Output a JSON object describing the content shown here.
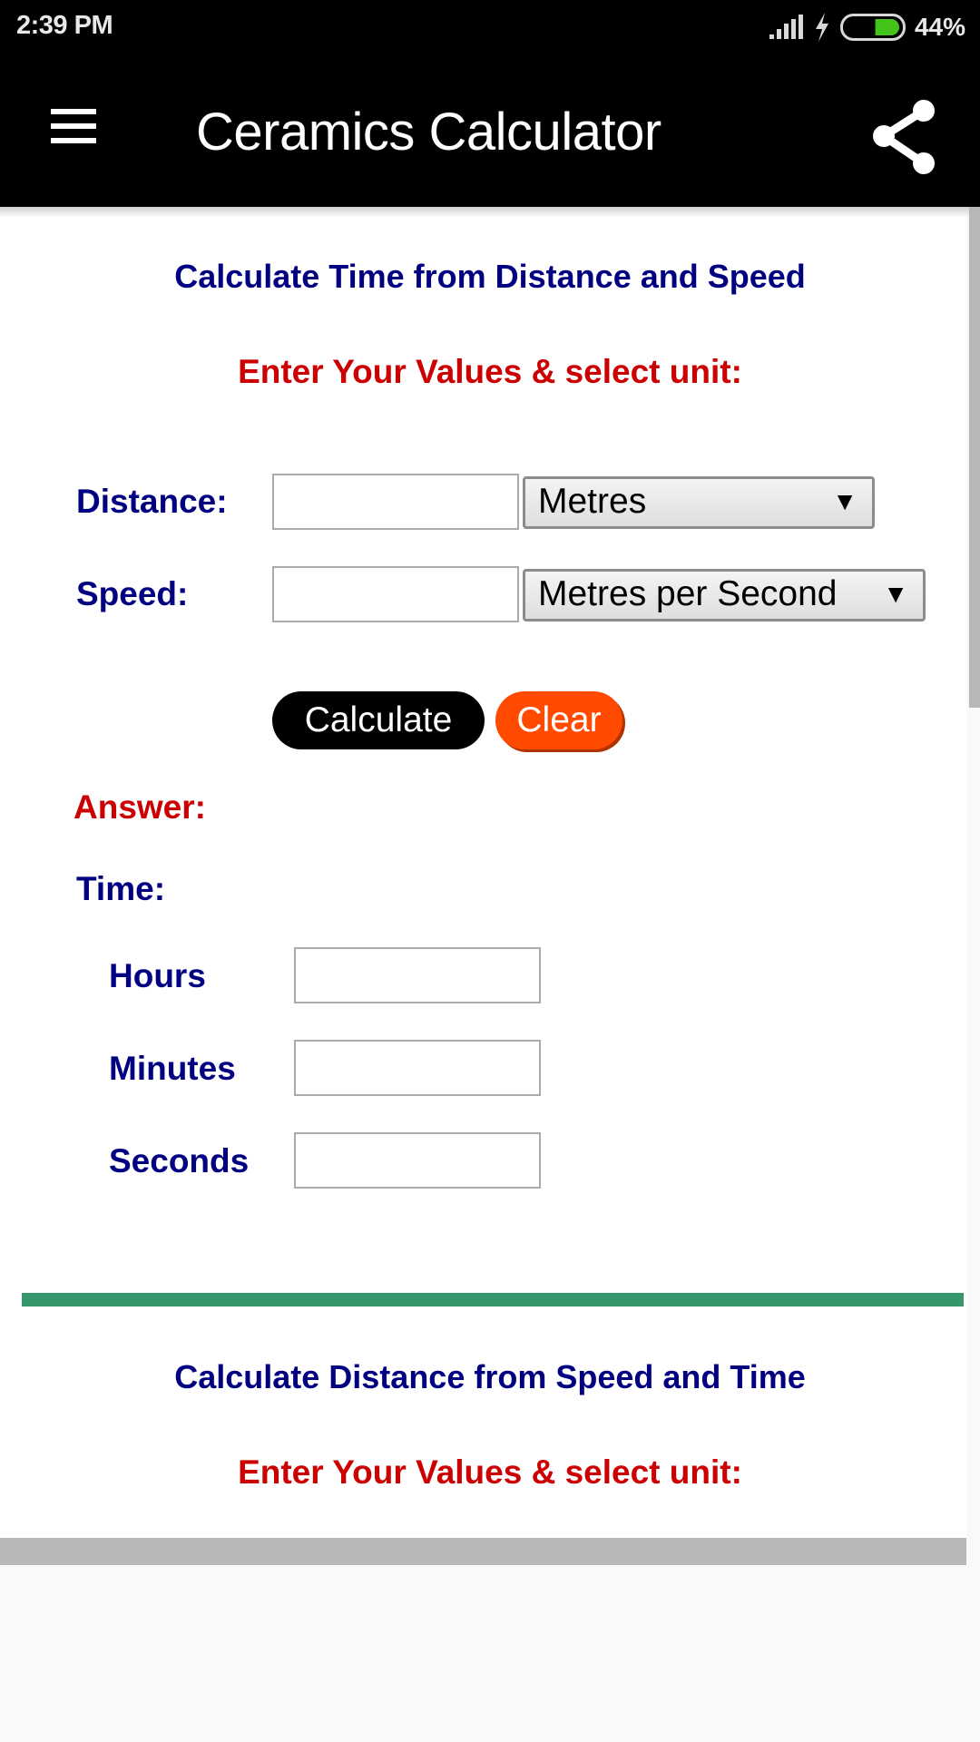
{
  "status_bar": {
    "time": "2:39 PM",
    "battery_percent": "44%",
    "battery_level": 0.44,
    "icons": [
      "signal-icon",
      "charging-bolt-icon",
      "battery-icon"
    ],
    "colors": {
      "battery_fill": "#44c41a"
    }
  },
  "app_bar": {
    "title": "Ceramics Calculator",
    "menu_icon": "hamburger-menu-icon",
    "share_icon": "share-icon"
  },
  "section_time": {
    "title": "Calculate Time from Distance and Speed",
    "subtitle": "Enter Your Values & select unit:",
    "distance": {
      "label": "Distance:",
      "value": "",
      "unit": "Metres"
    },
    "speed": {
      "label": "Speed:",
      "value": "",
      "unit": "Metres per Second"
    },
    "calculate_label": "Calculate",
    "clear_label": "Clear",
    "answer_label": "Answer:",
    "result_label": "Time:",
    "results": [
      {
        "label": "Hours",
        "value": ""
      },
      {
        "label": "Minutes",
        "value": ""
      },
      {
        "label": "Seconds",
        "value": ""
      }
    ]
  },
  "section_distance": {
    "title": "Calculate Distance from Speed and Time",
    "subtitle": "Enter Your Values & select unit:"
  },
  "colors": {
    "heading_blue": "#000080",
    "accent_red": "#cc0000",
    "clear_orange": "#ff4a00",
    "divider_green": "#36976a"
  }
}
